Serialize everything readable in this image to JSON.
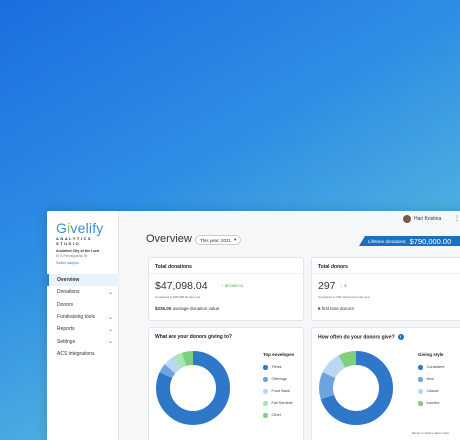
{
  "brand": {
    "logo_text_pre": "G",
    "logo_i": "i",
    "logo_text_post": "velify",
    "subtitle": "ANALYTICS STUDIO"
  },
  "church": {
    "name": "Anointed City of the Lord",
    "address": "67 S Pennsylvania, IN",
    "switch_label": "Switch campus"
  },
  "nav": [
    {
      "label": "Overview",
      "chevron": false,
      "active": true
    },
    {
      "label": "Donations",
      "chevron": true
    },
    {
      "label": "Donors",
      "chevron": false
    },
    {
      "label": "Fundraising tools",
      "chevron": true
    },
    {
      "label": "Reports",
      "chevron": true
    },
    {
      "label": "Settings",
      "chevron": true
    },
    {
      "label": "ACS integrations",
      "chevron": false
    }
  ],
  "header": {
    "user_name": "Hari Kristina",
    "title": "Overview",
    "year_select": "This year: 2021",
    "lifetime_label": "Lifetime donations:",
    "lifetime_value": "$790,000.00"
  },
  "total_donations": {
    "title": "Total donations",
    "value": "$47,098.04",
    "delta": "$2,000.04",
    "compare": "Compared to $45,098.00 last year",
    "sub_value": "$235.00",
    "sub_label": "average donation value"
  },
  "total_donors": {
    "title": "Total donors",
    "value": "297",
    "delta": "3",
    "compare": "Compared to 300 total donors last year",
    "sub_value": "6",
    "sub_label": "first time donors"
  },
  "giving_to": {
    "title": "What are your donors giving to?",
    "legend_title": "Top envelopes",
    "items": [
      {
        "label": "Tithes",
        "color": "#2f78c9",
        "value": 0.82
      },
      {
        "label": "Offerings",
        "color": "#6ea4de",
        "value": 0.04
      },
      {
        "label": "Food Bank",
        "color": "#b9d8f2",
        "value": 0.05
      },
      {
        "label": "Fall Seminar",
        "color": "#a9e5b3",
        "value": 0.04
      },
      {
        "label": "Other",
        "color": "#7ecf7e",
        "value": 0.05
      }
    ]
  },
  "how_often": {
    "title": "How often do your donors give?",
    "legend_title": "Giving style",
    "items": [
      {
        "label": "Consistent",
        "color": "#2f78c9",
        "value": 0.7
      },
      {
        "label": "New",
        "color": "#6ea4de",
        "value": 0.12
      },
      {
        "label": "Casual",
        "color": "#b9d8f2",
        "value": 0.1
      },
      {
        "label": "Inactive",
        "color": "#7ecf7e",
        "value": 0.08
      }
    ]
  },
  "footnote": "Based on lifetime data to date"
}
